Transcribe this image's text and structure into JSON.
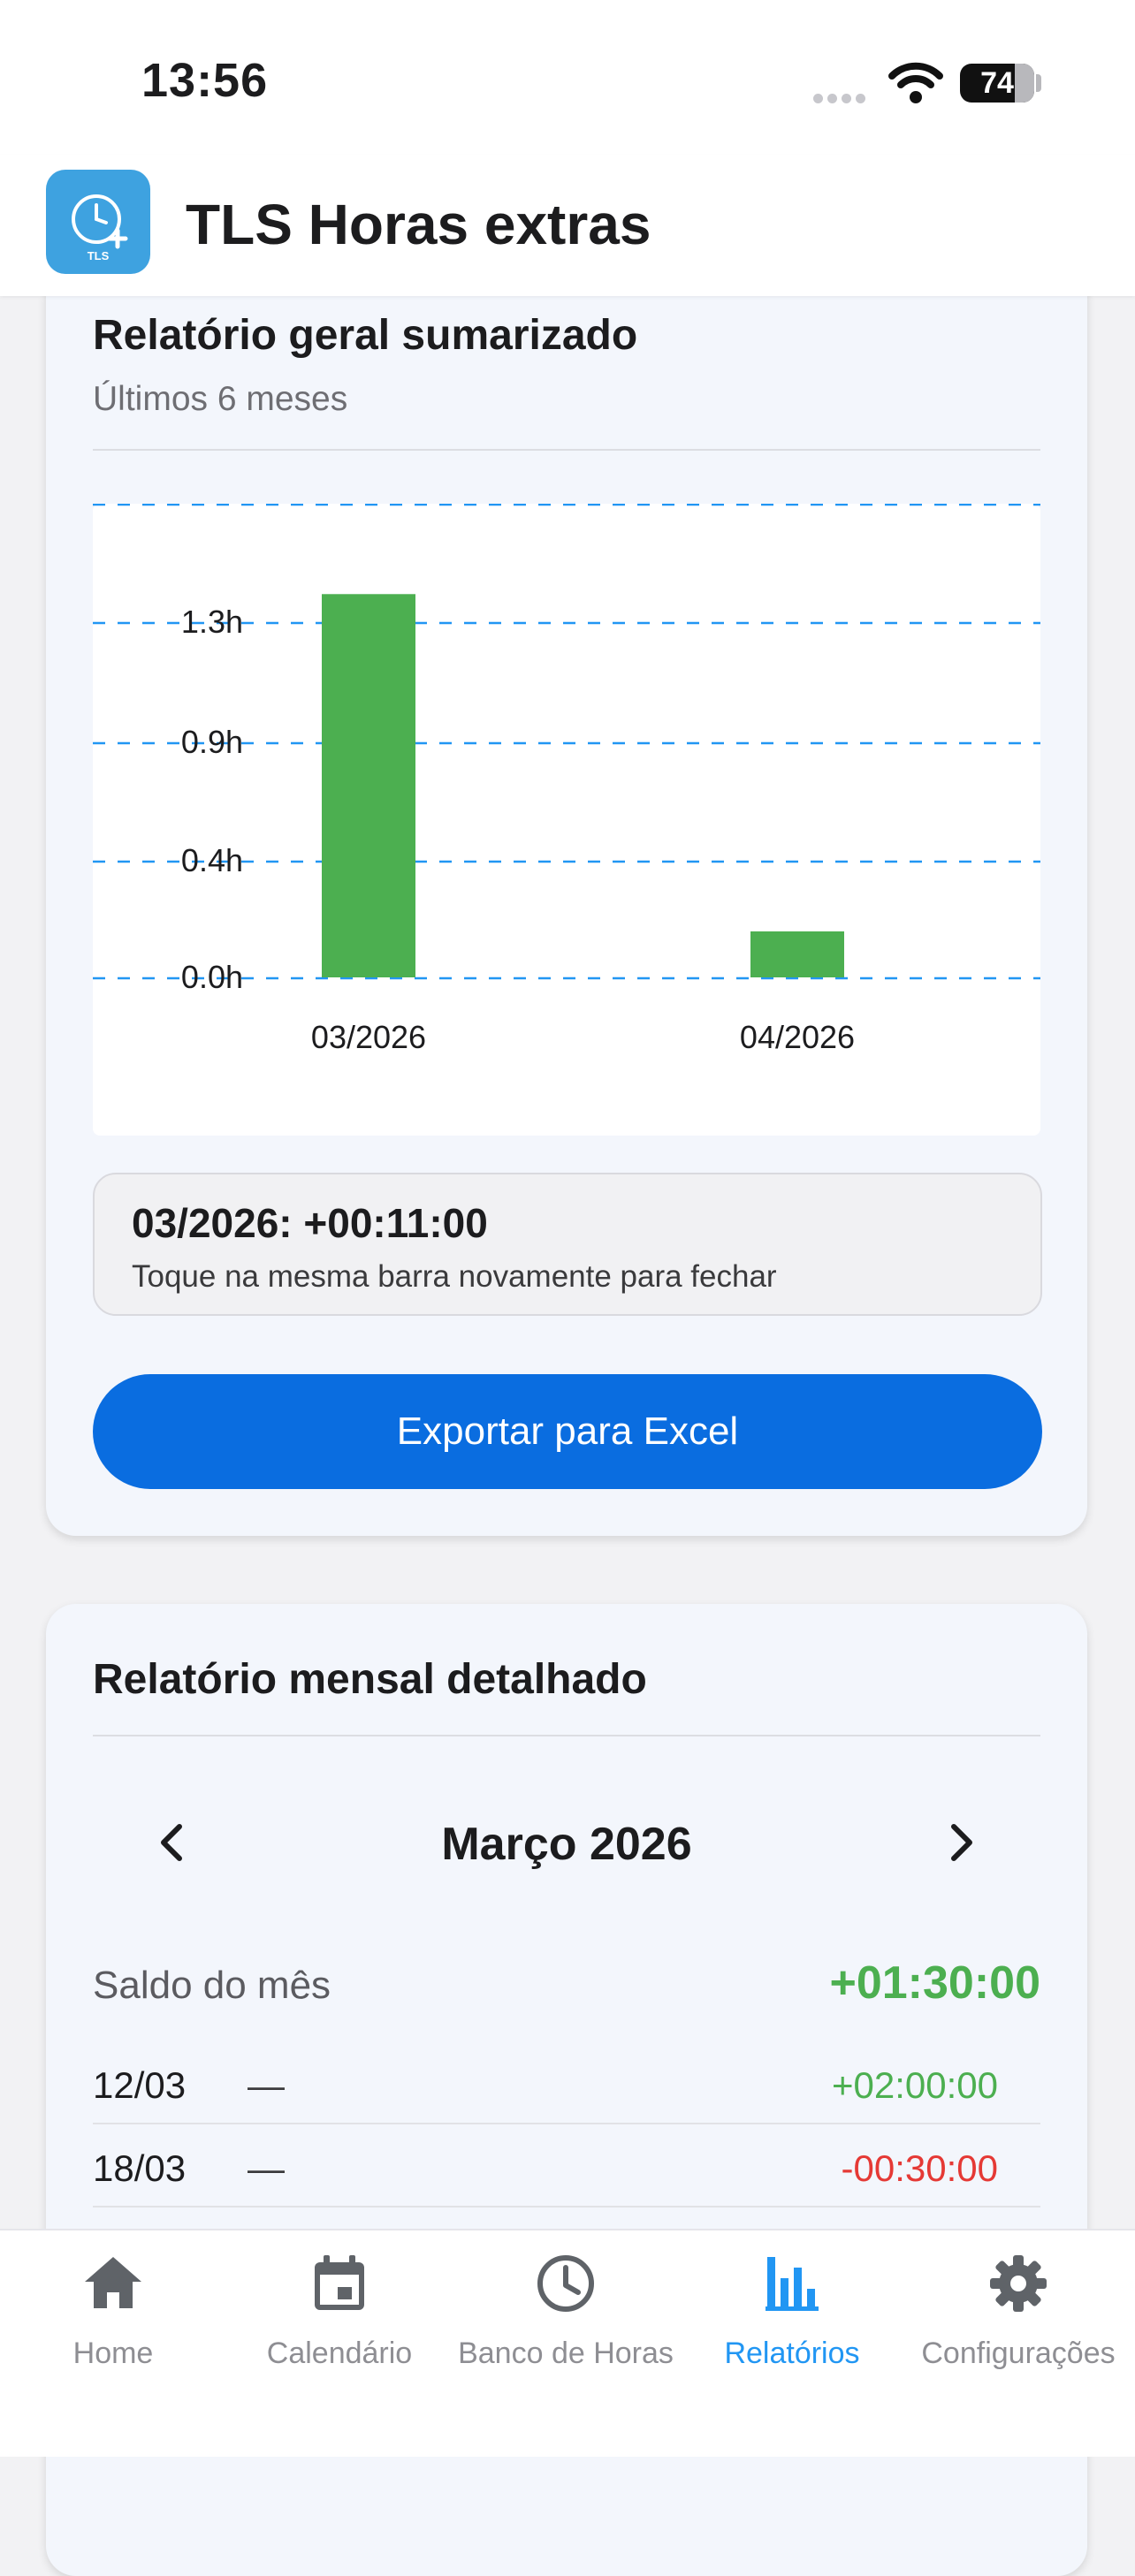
{
  "status_bar": {
    "time": "13:56",
    "battery": "74"
  },
  "app": {
    "title": "TLS Horas extras",
    "logo_text": "TLS"
  },
  "summary_card": {
    "title": "Relatório geral sumarizado",
    "subtitle": "Últimos 6 meses",
    "tooltip_title": "03/2026: +00:11:00",
    "tooltip_hint": "Toque na mesma barra novamente para fechar",
    "export_label": "Exportar para Excel"
  },
  "chart_data": {
    "type": "bar",
    "categories": [
      "03/2026",
      "04/2026"
    ],
    "values": [
      1.5,
      0.18
    ],
    "yticks": [
      "0.0h",
      "0.4h",
      "0.9h",
      "1.3h"
    ],
    "ylim": [
      0,
      1.75
    ],
    "grid": true,
    "grid_style": "dashed",
    "bar_color": "#4caf50",
    "grid_color": "#2196f3"
  },
  "monthly_card": {
    "title": "Relatório mensal detalhado",
    "month_label": "Março 2026",
    "balance_label": "Saldo do mês",
    "balance_value": "+01:30:00",
    "entries": [
      {
        "date": "12/03",
        "note": "—",
        "amount": "+02:00:00"
      },
      {
        "date": "18/03",
        "note": "—",
        "amount": "-00:30:00"
      }
    ]
  },
  "tabs": [
    {
      "label": "Home",
      "icon": "home-icon"
    },
    {
      "label": "Calendário",
      "icon": "calendar-icon"
    },
    {
      "label": "Banco de Horas",
      "icon": "clock-icon"
    },
    {
      "label": "Relatórios",
      "icon": "bar-chart-icon",
      "active": true
    },
    {
      "label": "Configurações",
      "icon": "gear-icon"
    }
  ],
  "colors": {
    "accent": "#0a6de0",
    "positive": "#4caf50",
    "negative": "#e53935",
    "tab_active": "#2196f3"
  }
}
